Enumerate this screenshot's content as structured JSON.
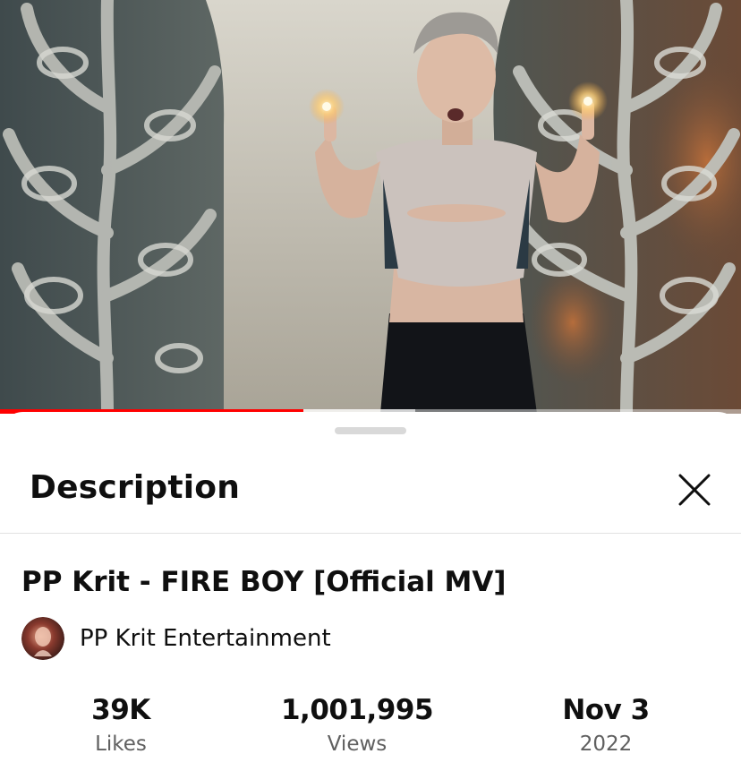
{
  "player": {
    "progress_played": 0.41,
    "progress_buffered": 0.56,
    "colors": {
      "progress": "#ff0000"
    }
  },
  "sheet": {
    "title": "Description",
    "close_icon": "close-icon"
  },
  "video": {
    "title": "PP Krit - FIRE BOY [Official MV]"
  },
  "channel": {
    "name": "PP Krit Entertainment"
  },
  "stats": [
    {
      "value": "39K",
      "label": "Likes"
    },
    {
      "value": "1,001,995",
      "label": "Views"
    },
    {
      "value": "Nov 3",
      "label": "2022"
    }
  ]
}
